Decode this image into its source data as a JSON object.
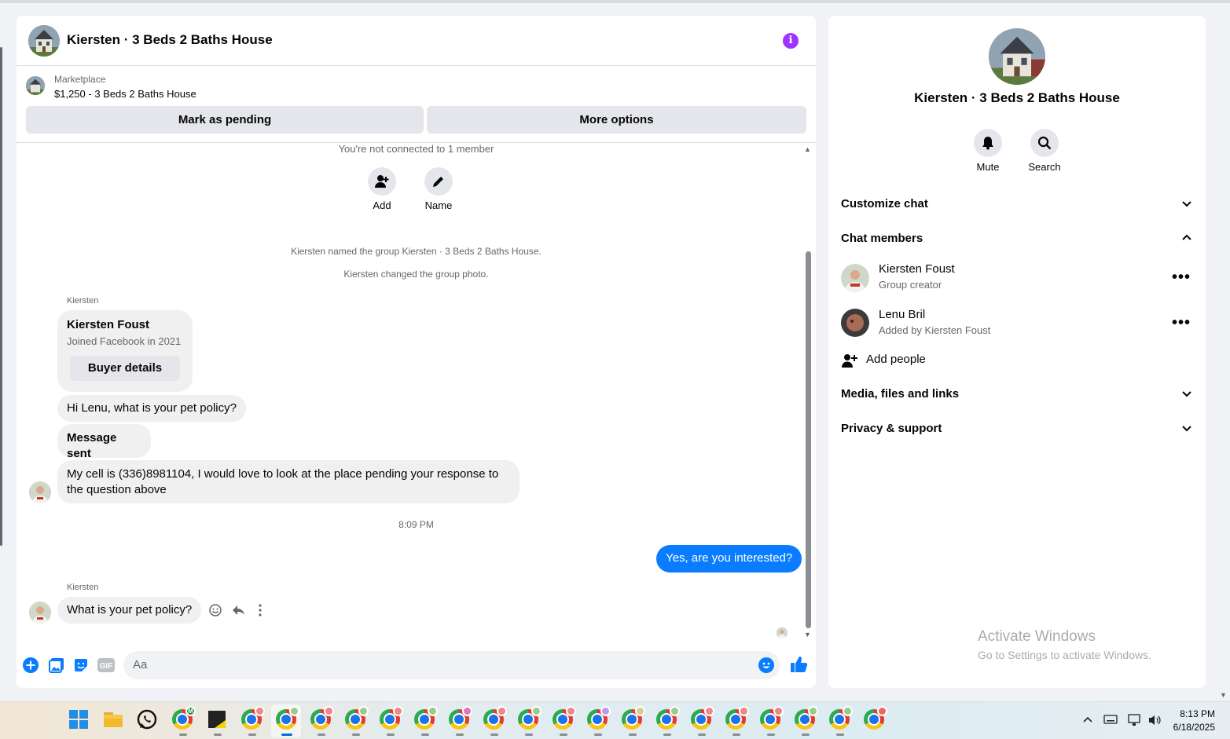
{
  "chat": {
    "title": "Kiersten · 3 Beds 2 Baths House",
    "info_icon": "i",
    "marketplace_label": "Marketplace",
    "listing": "$1,250 - 3 Beds 2 Baths House",
    "mark_pending": "Mark as pending",
    "more_options": "More options",
    "not_connected": "You're not connected to 1 member",
    "add_label": "Add",
    "name_label": "Name",
    "sys_named": "Kiersten named the group Kiersten · 3 Beds 2 Baths House.",
    "sys_photo": "Kiersten changed the group photo.",
    "sender_short": "Kiersten",
    "card_name": "Kiersten Foust",
    "card_sub": "Joined Facebook in 2021",
    "buyer_details": "Buyer details",
    "msg1": "Hi Lenu, what is your pet policy?",
    "msg2": "Message sent",
    "msg3": "My cell is (336)8981104, I would love to look at the place pending your response to the question above",
    "timestamp": "8:09 PM",
    "msg_out": "Yes, are you interested?",
    "msg4": "What is your pet policy?",
    "composer_placeholder": "Aa",
    "gif_label": "GIF"
  },
  "info": {
    "title": "Kiersten · 3 Beds 2 Baths House",
    "mute": "Mute",
    "search": "Search",
    "customize": "Customize chat",
    "members_header": "Chat members",
    "members": [
      {
        "name": "Kiersten Foust",
        "sub": "Group creator"
      },
      {
        "name": "Lenu Bril",
        "sub": "Added by Kiersten Foust"
      }
    ],
    "add_people": "Add people",
    "media": "Media, files and links",
    "privacy": "Privacy & support"
  },
  "watermark": {
    "line1": "Activate Windows",
    "line2": "Go to Settings to activate Windows."
  },
  "taskbar": {
    "time": "8:13 PM",
    "date": "6/18/2025",
    "whatsapp_letter": "M"
  },
  "colors": {
    "accent_blue": "#0a7cff",
    "info_purple": "#a033ff"
  }
}
